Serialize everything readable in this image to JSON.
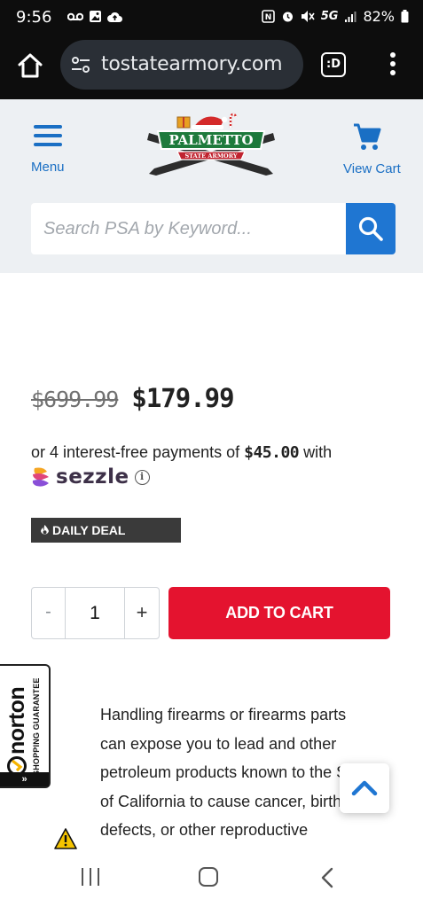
{
  "status_bar": {
    "time": "9:56",
    "network": "5G",
    "battery": "82%"
  },
  "browser": {
    "url": "tostatearmory.com",
    "tabs_label": ":D"
  },
  "header": {
    "menu_label": "Menu",
    "logo_text": "PALMETTO",
    "logo_subtext": "STATE ARMORY",
    "cart_label": "View Cart",
    "search_placeholder": "Search PSA by Keyword..."
  },
  "product": {
    "old_price": "$699.99",
    "new_price": "$179.99",
    "sezzle_prefix": "or 4 interest-free payments of",
    "sezzle_amount": "$45.00",
    "sezzle_suffix": "with",
    "sezzle_brand": "sezzle",
    "deal_badge": "DAILY DEAL",
    "quantity": "1",
    "qty_minus": "-",
    "qty_plus": "+",
    "add_to_cart": "ADD TO CART"
  },
  "norton": {
    "brand": "norton",
    "guarantee": "SHOPPING GUARANTEE",
    "arrow": "»"
  },
  "warning": {
    "text": "Handling firearms or firearms parts can expose you to lead and other petroleum products known to the State of California to cause cancer, birth defects, or other reproductive"
  },
  "colors": {
    "brand_blue": "#1f76d2",
    "cart_red": "#e4132f",
    "header_bg": "#edf0f3",
    "logo_green": "#1e7a3c"
  },
  "icons": [
    "home-icon",
    "site-settings-icon",
    "kebab-menu-icon",
    "hamburger-icon",
    "cart-icon",
    "search-icon",
    "info-icon",
    "flame-icon",
    "warning-icon",
    "chevron-up-icon"
  ]
}
